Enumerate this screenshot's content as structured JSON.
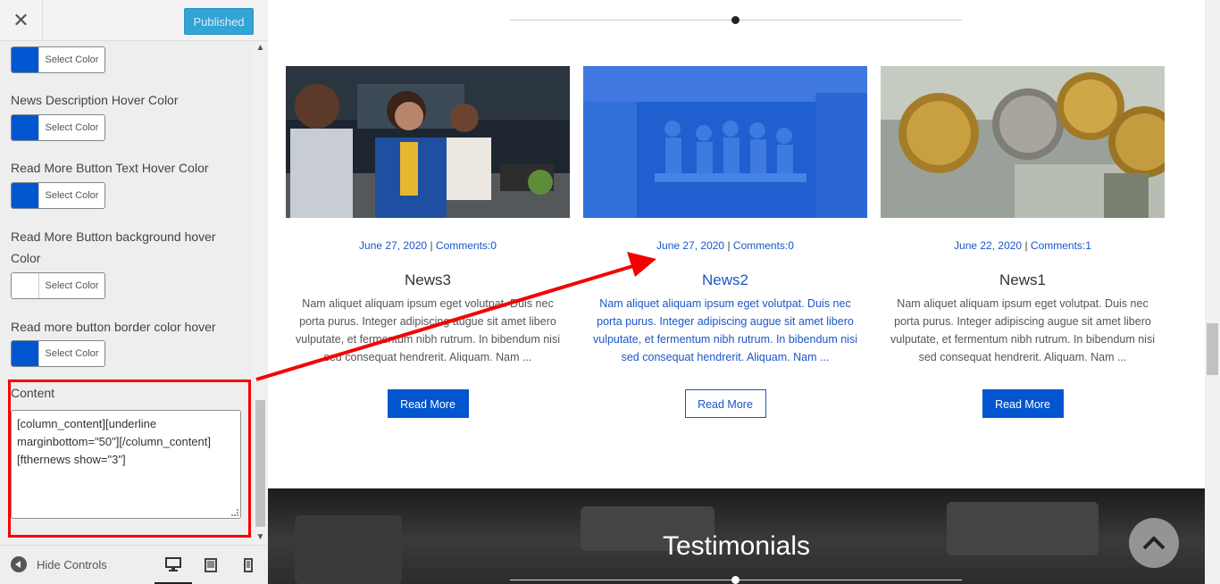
{
  "header": {
    "close_label": "✕",
    "publish_label": "Published"
  },
  "sidebar": {
    "first_color_button": "Select Color",
    "controls": [
      {
        "label": "News Description Hover Color",
        "button": "Select Color",
        "color": "#0156cf"
      },
      {
        "label": "Read More Button Text Hover Color",
        "button": "Select Color",
        "color": "#0156cf"
      },
      {
        "label": "Read More Button background hover Color",
        "button": "Select Color",
        "color": "#ffffff"
      },
      {
        "label": "Read more button border color hover",
        "button": "Select Color",
        "color": "#0156cf"
      }
    ],
    "content": {
      "label": "Content",
      "value": "[column_content][underline marginbottom=\"50\"][/column_content]\n[fthernews show=\"3\"]"
    }
  },
  "footer": {
    "hide_controls": "Hide Controls",
    "devices": [
      "desktop-icon",
      "tablet-icon",
      "mobile-icon"
    ]
  },
  "news": [
    {
      "date": "June 27, 2020",
      "sep": "|",
      "comments": "Comments:0",
      "title": "News3",
      "desc": "Nam aliquet aliquam ipsum eget volutpat. Duis nec porta purus. Integer adipiscing augue sit amet libero vulputate, et fermentum nibh rutrum. In bibendum nisi sed consequat hendrerit. Aliquam. Nam ...",
      "button": "Read More"
    },
    {
      "date": "June 27, 2020",
      "sep": "|",
      "comments": "Comments:0",
      "title": "News2",
      "desc": "Nam aliquet aliquam ipsum eget volutpat. Duis nec porta purus. Integer adipiscing augue sit amet libero vulputate, et fermentum nibh rutrum. In bibendum nisi sed consequat hendrerit. Aliquam. Nam ...",
      "button": "Read More"
    },
    {
      "date": "June 22, 2020",
      "sep": "|",
      "comments": "Comments:1",
      "title": "News1",
      "desc": "Nam aliquet aliquam ipsum eget volutpat. Duis nec porta purus. Integer adipiscing augue sit amet libero vulputate, et fermentum nibh rutrum. In bibendum nisi sed consequat hendrerit. Aliquam. Nam ...",
      "button": "Read More"
    }
  ],
  "testimonials": {
    "title": "Testimonials"
  },
  "colors": {
    "accent": "#0156cf",
    "publish": "#32a4d5",
    "annotation": "#f40000"
  }
}
